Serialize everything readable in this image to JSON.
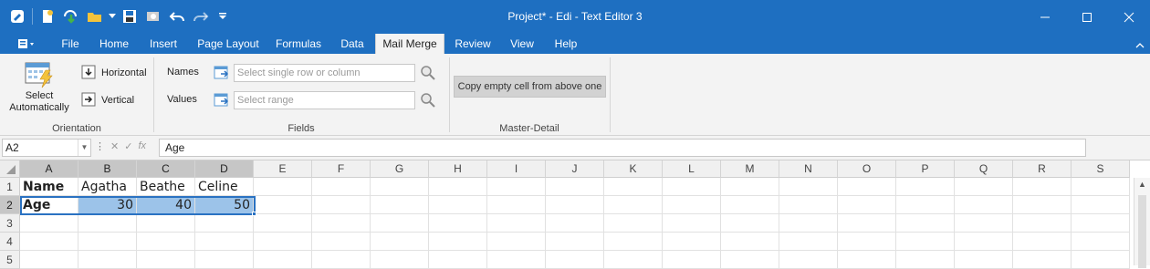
{
  "window": {
    "title": "Project* - Edi - Text Editor 3"
  },
  "quick_access": {
    "icons": [
      "app-icon",
      "new-document-icon",
      "save-green-icon",
      "open-folder-icon",
      "dropdown-icon",
      "save-icon",
      "print-preview-icon",
      "undo-icon",
      "redo-icon",
      "customize-icon"
    ]
  },
  "tabs": [
    {
      "label": "File"
    },
    {
      "label": "Home"
    },
    {
      "label": "Insert"
    },
    {
      "label": "Page Layout"
    },
    {
      "label": "Formulas"
    },
    {
      "label": "Data"
    },
    {
      "label": "Mail Merge"
    },
    {
      "label": "Review"
    },
    {
      "label": "View"
    },
    {
      "label": "Help"
    }
  ],
  "ribbon": {
    "orientation": {
      "select_label_1": "Select",
      "select_label_2": "Automatically",
      "horizontal_label": "Horizontal",
      "vertical_label": "Vertical",
      "group_label": "Orientation"
    },
    "fields": {
      "names_label": "Names",
      "names_placeholder": "Select single row or column",
      "values_label": "Values",
      "values_placeholder": "Select range",
      "group_label": "Fields"
    },
    "master_detail": {
      "copy_button_label": "Copy empty cell from above one",
      "group_label": "Master-Detail"
    }
  },
  "formula_bar": {
    "name_box": "A2",
    "formula": "Age"
  },
  "sheet": {
    "columns": [
      "A",
      "B",
      "C",
      "D",
      "E",
      "F",
      "G",
      "H",
      "I",
      "J",
      "K",
      "L",
      "M",
      "N",
      "O",
      "P",
      "Q",
      "R",
      "S"
    ],
    "rows": [
      "1",
      "2",
      "3",
      "4",
      "5"
    ],
    "cells": {
      "A1": "Name",
      "B1": "Agatha",
      "C1": "Beathe",
      "D1": "Celine",
      "A2": "Age",
      "B2": "30",
      "C2": "40",
      "D2": "50"
    }
  },
  "colors": {
    "accent": "#1e6fc1",
    "selection_fill": "#9cc3e9",
    "selection_border": "#2a72c2"
  }
}
